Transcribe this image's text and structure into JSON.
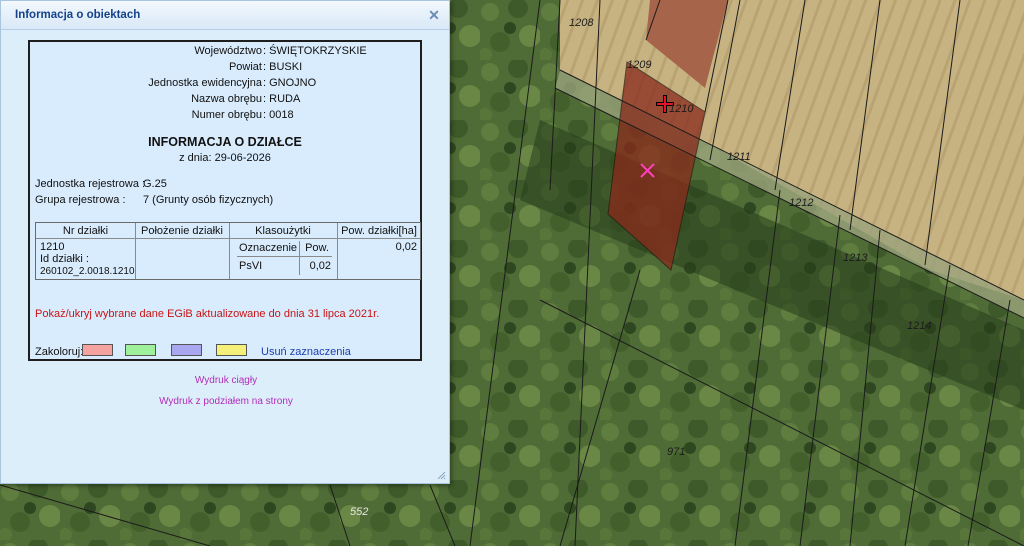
{
  "window": {
    "title": "Informacja o obiektach",
    "close_glyph": "✕"
  },
  "header_fields": [
    {
      "label": "Województwo",
      "value": "ŚWIĘTOKRZYSKIE"
    },
    {
      "label": "Powiat",
      "value": "BUSKI"
    },
    {
      "label": "Jednostka ewidencyjna",
      "value": "GNOJNO"
    },
    {
      "label": "Nazwa obrębu",
      "value": "RUDA"
    },
    {
      "label": "Numer obrębu",
      "value": "0018"
    }
  ],
  "separator": ":",
  "title": "INFORMACJA O DZIAŁCE",
  "date_line": "z dnia: 29-06-2026",
  "registry": [
    {
      "label": "Jednostka rejestrowa",
      "value": "G.25"
    },
    {
      "label": "Grupa rejestrowa",
      "value": "7 (Grunty osób fizycznych)"
    }
  ],
  "table": {
    "headers": [
      "Nr działki",
      "Położenie działki",
      "Klasoużytki",
      "Pow. działki[ha]"
    ],
    "sub_headers": [
      "Oznaczenie",
      "Pow."
    ],
    "row": {
      "parcel_no": "1210",
      "id_label": "Id działki :",
      "id_value": "260102_2.0018.1210",
      "location": "",
      "class_symbol": "PsVI",
      "class_area": "0,02",
      "area": "0,02"
    }
  },
  "egib_note": "Pokaż/ukryj wybrane dane EGiB aktualizowane do dnia 31 lipca 2021r.",
  "color_label": "Zakoloruj:",
  "swatch_colors": [
    "#f4a3a0",
    "#9ff09a",
    "#a9a7ef",
    "#f4f07a"
  ],
  "clear_selection": "Usuń zaznaczenia",
  "print_continuous": "Wydruk ciągły",
  "print_paged": "Wydruk z podziałem na strony",
  "map": {
    "parcel_labels": [
      "1208",
      "1209",
      "1210",
      "1211",
      "1212",
      "1213",
      "1214",
      "971",
      "552"
    ],
    "selected_parcel_color": "#8a2a1c"
  }
}
